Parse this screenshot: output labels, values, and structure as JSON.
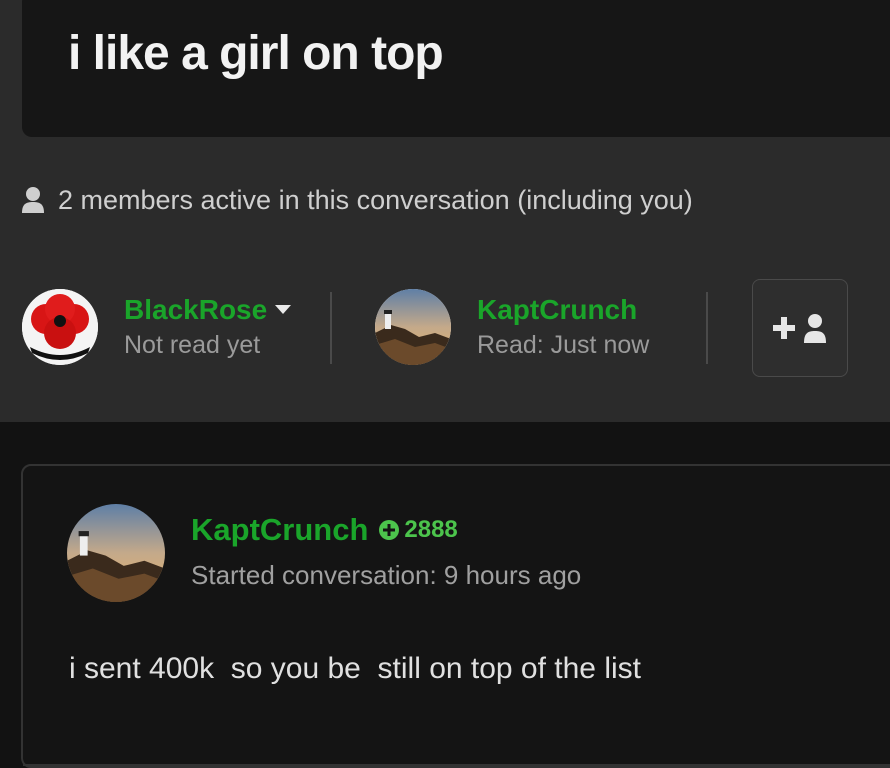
{
  "conversation": {
    "title": "i like a girl on top"
  },
  "members_info": {
    "text": "2 members active in this conversation (including you)",
    "icon": "user-icon"
  },
  "members": [
    {
      "name": "BlackRose",
      "status": "Not read yet",
      "avatar": "poppy-avatar",
      "has_menu": true
    },
    {
      "name": "KaptCrunch",
      "status": "Read: Just now",
      "avatar": "lighthouse-avatar",
      "has_menu": false
    }
  ],
  "add_member_button": {
    "icon": "add-user-icon"
  },
  "message": {
    "author": "KaptCrunch",
    "reputation": "2888",
    "meta": "Started conversation: 9 hours ago",
    "body": "i sent 400k  so you be  still on top of the list"
  },
  "colors": {
    "username": "#1aa52a",
    "reputation": "#4cc44c",
    "background": "#121212",
    "panel": "#2b2b2b"
  }
}
